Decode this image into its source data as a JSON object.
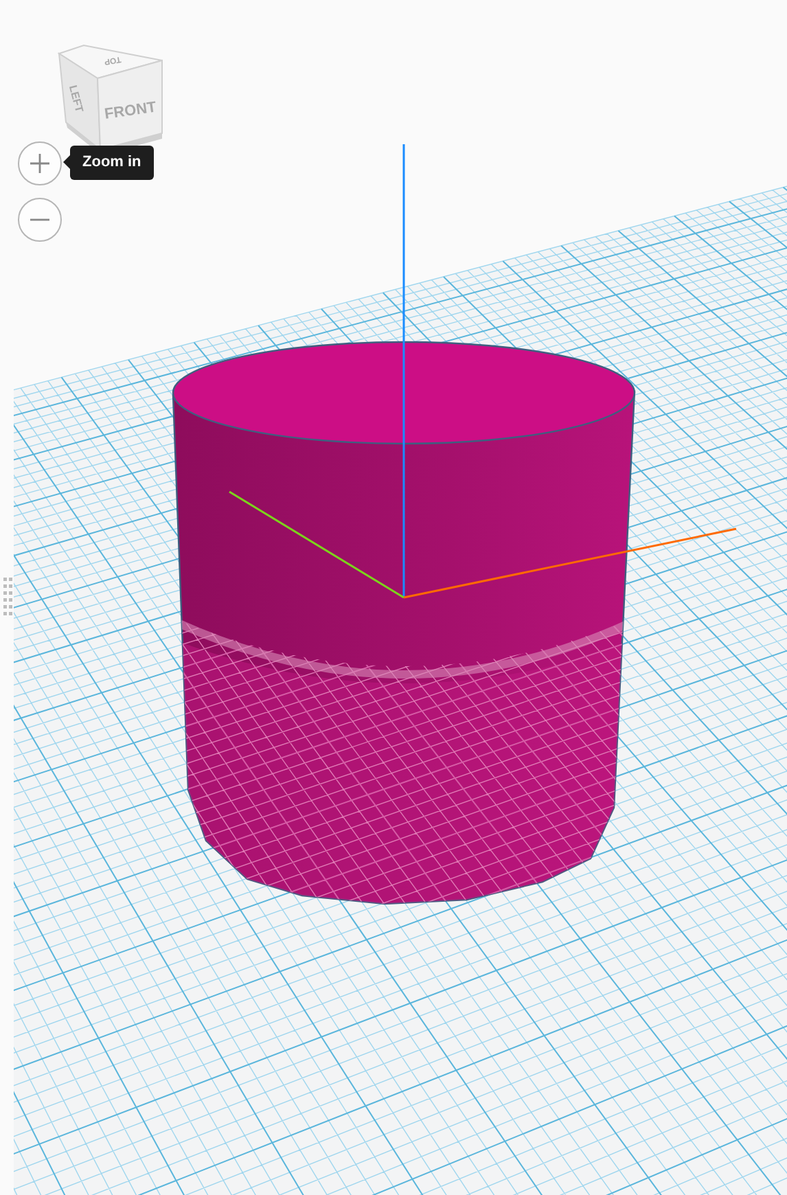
{
  "view_cube": {
    "faces": [
      {
        "kind": "top",
        "label": "TOP"
      },
      {
        "kind": "left",
        "label": "LEFT"
      },
      {
        "kind": "front",
        "label": "FRONT"
      }
    ]
  },
  "zoom_controls": [
    {
      "kind": "zoom_in"
    },
    {
      "kind": "zoom_out"
    }
  ],
  "tooltip": {
    "text": "Zoom in"
  }
}
